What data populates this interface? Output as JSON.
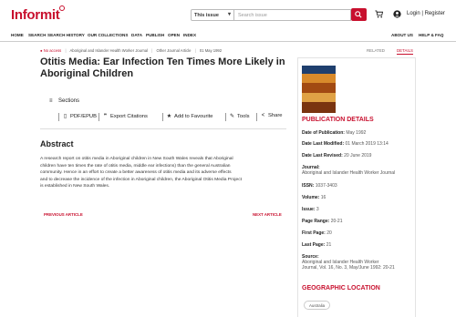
{
  "header": {
    "logo_text": "Informit",
    "scope_select": "This issue",
    "search_placeholder": "Search issue",
    "login_label": "Login | Register",
    "brand_color": "#c8102e"
  },
  "nav": {
    "left": [
      "HOME",
      "SEARCH",
      "SEARCH HISTORY",
      "OUR COLLECTIONS",
      "DATA",
      "PUBLISH",
      "OPEN",
      "INDEX"
    ],
    "right": [
      "ABOUT US",
      "HELP & FAQ"
    ]
  },
  "breadcrumb": {
    "access": "No access",
    "journal": "Aboriginal and Islander Health Worker Journal",
    "type": "Other Journal Article",
    "date": "01 May 1992"
  },
  "panel_tabs": {
    "related": "RELATED",
    "details": "DETAILS"
  },
  "article": {
    "title": "Otitis Media: Ear Infection Ten Times More Likely in Aboriginal Children",
    "sections_label": "Sections",
    "actions": {
      "pdf": "PDF/EPUB",
      "cite": "Export Citations",
      "fav": "Add to Favourite",
      "tools": "Tools",
      "share": "Share"
    },
    "abstract_heading": "Abstract",
    "abstract_lines": [
      "A research report on otitis media in Aboriginal children in New South Wales reveals that Aboriginal",
      "children have ten times the rate of otitis media, middle ear infections) than the general Australian",
      "community. Hence in an effort to create a better awareness of otitis media and its adverse effects",
      "and to decrease the incidence of the infection in Aboriginal children, the Aboriginal Otitis Media Project",
      "is established in New South Wales."
    ],
    "prev": "PREVIOUS ARTICLE",
    "next": "NEXT ARTICLE"
  },
  "publication": {
    "heading": "PUBLICATION DETAILS",
    "date_of_publication": {
      "k": "Date of Publication:",
      "v": "May 1992"
    },
    "date_last_modified": {
      "k": "Date Last Modified:",
      "v": "01 March 2019 13:14"
    },
    "date_last_revised": {
      "k": "Date Last Revised:",
      "v": "20 June 2019"
    },
    "journal_k": "Journal:",
    "journal_v": "Aboriginal and Islander Health Worker Journal",
    "issn": {
      "k": "ISSN:",
      "v": "1037-3403"
    },
    "volume": {
      "k": "Volume:",
      "v": "16"
    },
    "issue": {
      "k": "Issue:",
      "v": "3"
    },
    "page_range": {
      "k": "Page Range:",
      "v": "20-21"
    },
    "first_page": {
      "k": "First Page:",
      "v": "20"
    },
    "last_page": {
      "k": "Last Page:",
      "v": "21"
    },
    "source_k": "Source:",
    "source_lines": [
      "Aboriginal and Islander Health Worker",
      "Journal, Vol. 16, No. 3, May/June 1992: 20-21"
    ],
    "geo_heading": "GEOGRAPHIC LOCATION",
    "geo_tag": "Australia"
  }
}
